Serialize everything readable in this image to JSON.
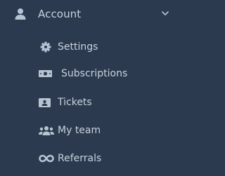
{
  "menu": {
    "account": {
      "label": "Account",
      "icon": "user-icon",
      "expanded": true
    },
    "items": [
      {
        "label": "Settings",
        "icon": "gear-icon"
      },
      {
        "label": "Subscriptions",
        "icon": "money-bill-icon"
      },
      {
        "label": "Tickets",
        "icon": "id-card-icon"
      },
      {
        "label": "My team",
        "icon": "users-icon"
      },
      {
        "label": "Referrals",
        "icon": "infinity-icon"
      }
    ]
  },
  "colors": {
    "background": "#2b3a4e",
    "text": "#c9d3df",
    "icon": "#b8c4d2"
  }
}
